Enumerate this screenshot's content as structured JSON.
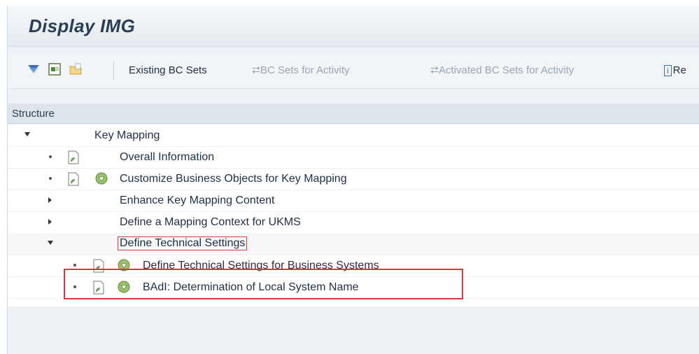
{
  "window": {
    "title": "Display IMG"
  },
  "toolbar": {
    "icons": [
      "tree-filter-icon",
      "document-icon",
      "folder-icon"
    ],
    "existing_bc_sets": "Existing BC Sets",
    "bc_sets_for_activity": "BC Sets for Activity",
    "activated_bc_sets": "Activated BC Sets for Activity",
    "release_notes": "Re"
  },
  "tree_header": {
    "label": "Structure"
  },
  "tree": {
    "items": [
      {
        "label": "Key Mapping"
      },
      {
        "label": "Overall Information"
      },
      {
        "label": "Customize Business Objects for Key Mapping"
      },
      {
        "label": "Enhance Key Mapping Content"
      },
      {
        "label": "Define a Mapping Context for UKMS"
      },
      {
        "label": "Define Technical Settings"
      },
      {
        "label": "Define Technical Settings for Business Systems"
      },
      {
        "label": "BAdI: Determination of Local System Name"
      }
    ]
  },
  "colors": {
    "highlight": "#d9363e",
    "title": "#2b3d54"
  }
}
